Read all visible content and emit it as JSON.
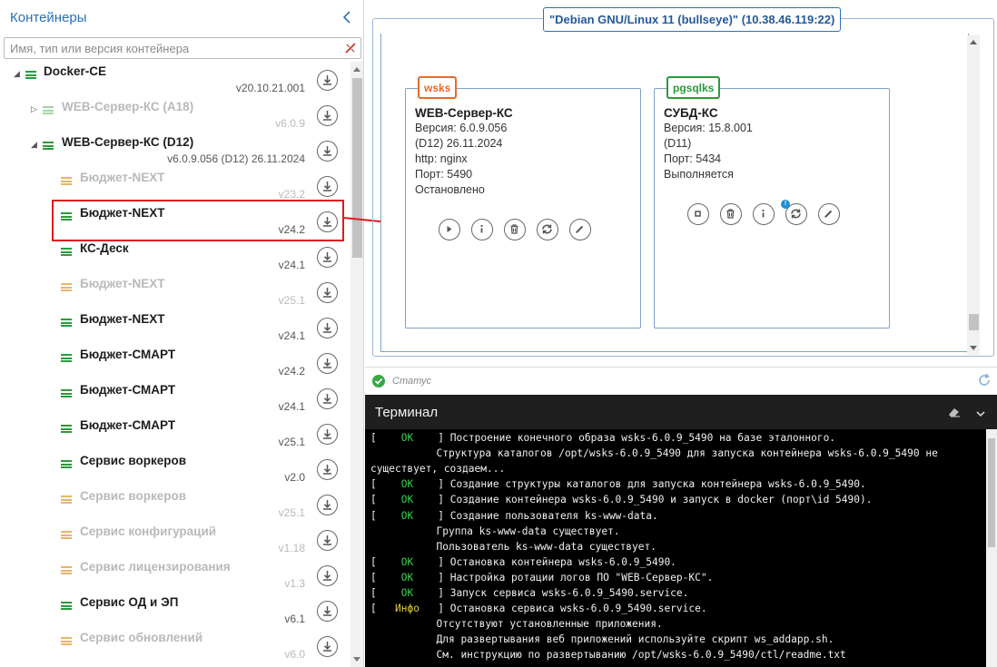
{
  "sidebar": {
    "title": "Контейнеры",
    "search_placeholder": "Имя, тип или версия контейнера",
    "items": [
      {
        "name": "Docker-CE",
        "version": "v20.10.21.001",
        "dim": false,
        "level": 0,
        "arrow": "expanded",
        "icon_color": "#2b9a3b"
      },
      {
        "name": "WEB-Сервер-КС (A18)",
        "version": "v6.0.9",
        "dim": true,
        "level": 1,
        "arrow": "collapsed",
        "icon_color": "#9fd6a5"
      },
      {
        "name": "WEB-Сервер-КС (D12)",
        "version": "v6.0.9.056 (D12) 26.11.2024",
        "dim": false,
        "level": 1,
        "arrow": "expanded",
        "icon_color": "#2b9a3b"
      },
      {
        "name": "Бюджет-NEXT",
        "version": "v23.2",
        "dim": true,
        "level": 2,
        "arrow": "",
        "icon_color": "#e8b56a"
      },
      {
        "name": "Бюджет-NEXT",
        "version": "v24.2",
        "dim": false,
        "level": 2,
        "arrow": "",
        "icon_color": "#2b9a3b"
      },
      {
        "name": "КС-Деск",
        "version": "v24.1",
        "dim": false,
        "level": 2,
        "arrow": "",
        "icon_color": "#2b9a3b"
      },
      {
        "name": "Бюджет-NEXT",
        "version": "v25.1",
        "dim": true,
        "level": 2,
        "arrow": "",
        "icon_color": "#e8b56a"
      },
      {
        "name": "Бюджет-NEXT",
        "version": "v24.1",
        "dim": false,
        "level": 2,
        "arrow": "",
        "icon_color": "#2b9a3b"
      },
      {
        "name": "Бюджет-СМАРТ",
        "version": "v24.2",
        "dim": false,
        "level": 2,
        "arrow": "",
        "icon_color": "#2b9a3b"
      },
      {
        "name": "Бюджет-СМАРТ",
        "version": "v24.1",
        "dim": false,
        "level": 2,
        "arrow": "",
        "icon_color": "#2b9a3b"
      },
      {
        "name": "Бюджет-СМАРТ",
        "version": "v25.1",
        "dim": false,
        "level": 2,
        "arrow": "",
        "icon_color": "#2b9a3b"
      },
      {
        "name": "Сервис воркеров",
        "version": "v2.0",
        "dim": false,
        "level": 2,
        "arrow": "",
        "icon_color": "#2b9a3b"
      },
      {
        "name": "Сервис воркеров",
        "version": "v25.1",
        "dim": true,
        "level": 2,
        "arrow": "",
        "icon_color": "#e8b56a"
      },
      {
        "name": "Сервис конфигураций",
        "version": "v1.18",
        "dim": true,
        "level": 2,
        "arrow": "",
        "icon_color": "#e8b56a"
      },
      {
        "name": "Сервис лицензирования",
        "version": "v1.3",
        "dim": true,
        "level": 2,
        "arrow": "",
        "icon_color": "#e8b56a"
      },
      {
        "name": "Сервис ОД и ЭП",
        "version": "v6.1",
        "dim": false,
        "level": 2,
        "arrow": "",
        "icon_color": "#2b9a3b"
      },
      {
        "name": "Сервис обновлений",
        "version": "v6.0",
        "dim": true,
        "level": 2,
        "arrow": "",
        "icon_color": "#e8b56a"
      }
    ]
  },
  "host": {
    "label": "\"Debian GNU/Linux 11 (bullseye)\" (10.38.46.119:22)"
  },
  "cards": [
    {
      "tag": "wsks",
      "tag_color": "orange",
      "title": "WEB-Сервер-КС",
      "lines": [
        "Версия: 6.0.9.056",
        "(D12) 26.11.2024",
        "http: nginx",
        "Порт: 5490",
        "Остановлено"
      ],
      "actions": [
        "play-icon",
        "info-icon",
        "trash-icon",
        "sync-icon",
        "edit-icon"
      ]
    },
    {
      "tag": "pgsqlks",
      "tag_color": "green",
      "title": "СУБД-КС",
      "lines": [
        "Версия: 15.8.001",
        "(D11)",
        "Порт: 5434",
        "Выполняется"
      ],
      "actions": [
        "stop-icon",
        "trash-icon",
        "info-icon",
        "sync-icon",
        "edit-icon"
      ],
      "sync_badge": "!"
    }
  ],
  "status": {
    "label": "Статус"
  },
  "terminal": {
    "title": "Терминал",
    "lines": [
      {
        "status": "OK",
        "text": "Построение конечного образа wsks-6.0.9_5490 на базе эталонного."
      },
      {
        "status": "",
        "text": "Структура каталогов /opt/wsks-6.0.9_5490 для запуска контейнера wsks-6.0.9_5490 не"
      },
      {
        "status": "",
        "text": "существует, создаем...",
        "wrap": true
      },
      {
        "status": "OK",
        "text": "Создание структуры каталогов для запуска контейнера wsks-6.0.9_5490."
      },
      {
        "status": "OK",
        "text": "Создание контейнера wsks-6.0.9_5490 и запуск в docker (порт\\id 5490)."
      },
      {
        "status": "OK",
        "text": "Создание пользователя ks-www-data."
      },
      {
        "status": "",
        "text": "Группа ks-www-data существует."
      },
      {
        "status": "",
        "text": "Пользователь ks-www-data существует."
      },
      {
        "status": "OK",
        "text": "Остановка контейнера wsks-6.0.9_5490."
      },
      {
        "status": "OK",
        "text": "Настройка ротации логов ПО \"WEB-Сервер-КС\"."
      },
      {
        "status": "OK",
        "text": "Запуск сервиса wsks-6.0.9_5490.service."
      },
      {
        "status": "Инфо",
        "text": "Остановка сервиса wsks-6.0.9_5490.service."
      },
      {
        "status": "",
        "text": "Отсутствуют установленные приложения."
      },
      {
        "status": "",
        "text": "Для развертывания веб приложений используйте скрипт ws_addapp.sh."
      },
      {
        "status": "",
        "text": "См. инструкцию по развертыванию /opt/wsks-6.0.9_5490/ctl/readme.txt"
      }
    ]
  },
  "colors": {
    "accent": "#2a6fb0",
    "highlight": "#e01b1b",
    "ok": "#3bd24a",
    "info": "#e6cf3b"
  }
}
